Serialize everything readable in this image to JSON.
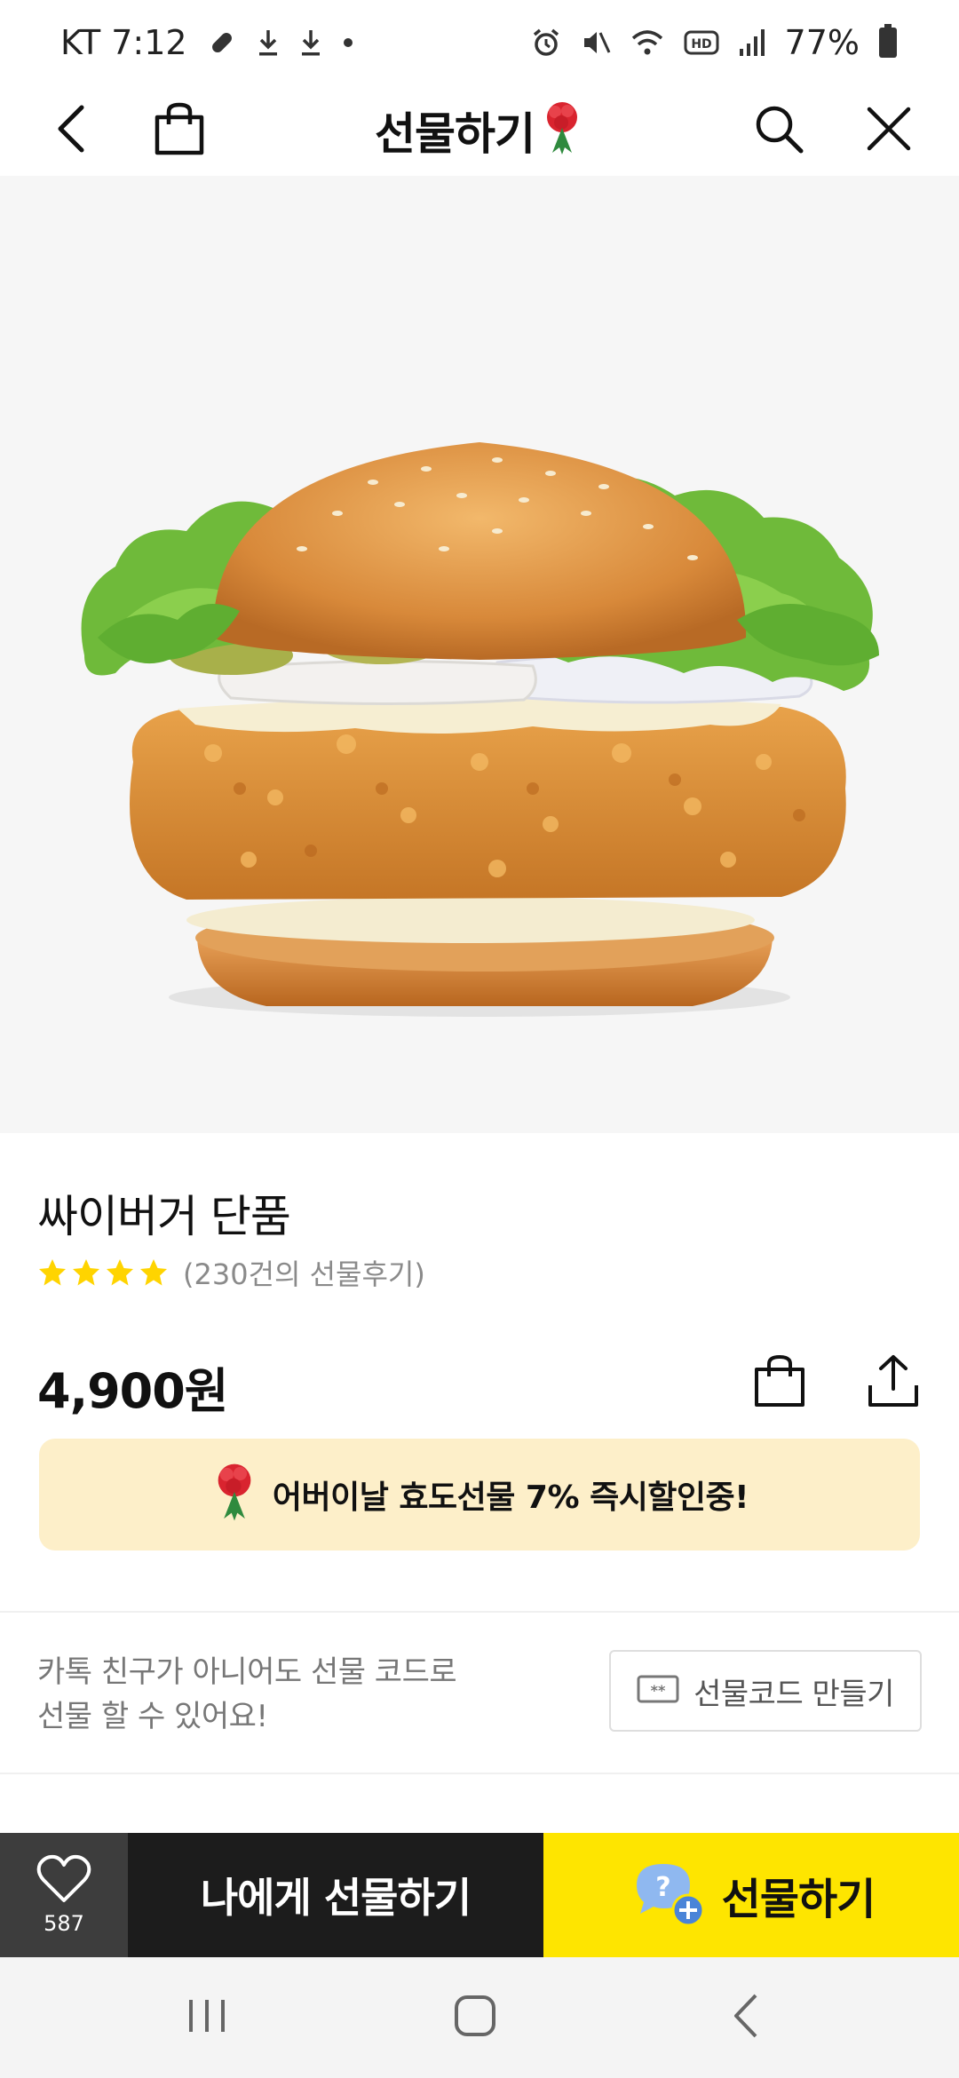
{
  "status_bar": {
    "carrier_time": "KT 7:12",
    "battery": "77%"
  },
  "header": {
    "title": "선물하기"
  },
  "product": {
    "name": "싸이버거 단품",
    "rating_stars": 4,
    "review_count": "(230건의 선물후기)",
    "price": "4,900원"
  },
  "promo": {
    "text": "어버이날 효도선물 7% 즉시할인중!"
  },
  "gift_code": {
    "description_line1": "카톡 친구가 아니어도 선물 코드로",
    "description_line2": "선물 할 수 있어요!",
    "button_label": "선물코드 만들기"
  },
  "action_bar": {
    "wish_count": "587",
    "gift_to_me_label": "나에게 선물하기",
    "gift_label": "선물하기"
  },
  "colors": {
    "accent_yellow": "#fee500",
    "promo_bg": "#fdefc9",
    "star": "#ffd400",
    "dark_button": "#1c1c1c"
  },
  "icons": [
    "back-arrow-icon",
    "shopping-bag-icon",
    "carnation-icon",
    "search-icon",
    "close-icon",
    "star-icon",
    "share-icon",
    "gift-code-ticket-icon",
    "heart-icon",
    "gift-friend-icon",
    "recents-icon",
    "home-icon",
    "nav-back-icon"
  ]
}
